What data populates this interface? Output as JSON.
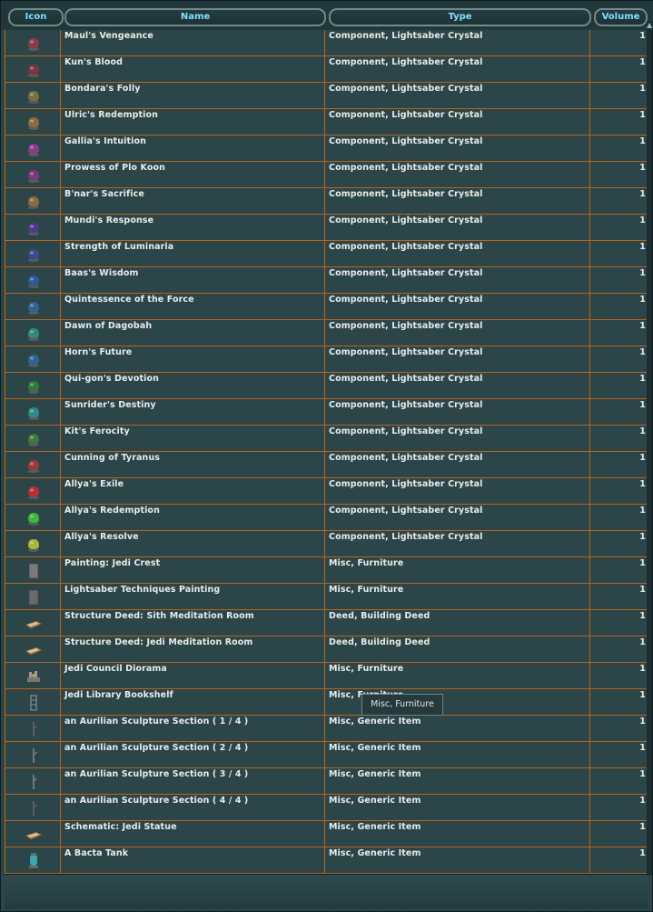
{
  "columns": {
    "icon": "Icon",
    "name": "Name",
    "type": "Type",
    "volume": "Volume"
  },
  "rows": [
    {
      "name": "Maul's Vengeance",
      "type": "Component, Lightsaber Crystal",
      "volume": "1",
      "icon": "crystal-icon",
      "color": "#8a3b46"
    },
    {
      "name": "Kun's Blood",
      "type": "Component, Lightsaber Crystal",
      "volume": "1",
      "icon": "crystal-icon",
      "color": "#7d3440"
    },
    {
      "name": "Bondara's Folly",
      "type": "Component, Lightsaber Crystal",
      "volume": "1",
      "icon": "crystal-icon",
      "color": "#7a6e3e"
    },
    {
      "name": "Ulric's Redemption",
      "type": "Component, Lightsaber Crystal",
      "volume": "1",
      "icon": "crystal-icon",
      "color": "#8a6b3a"
    },
    {
      "name": "Gallia's Intuition",
      "type": "Component, Lightsaber Crystal",
      "volume": "1",
      "icon": "crystal-icon",
      "color": "#8b3a8a"
    },
    {
      "name": "Prowess of Plo Koon",
      "type": "Component, Lightsaber Crystal",
      "volume": "1",
      "icon": "crystal-icon",
      "color": "#7b3a78"
    },
    {
      "name": "B'nar's Sacrifice",
      "type": "Component, Lightsaber Crystal",
      "volume": "1",
      "icon": "crystal-icon",
      "color": "#8a6a3f"
    },
    {
      "name": "Mundi's Response",
      "type": "Component, Lightsaber Crystal",
      "volume": "1",
      "icon": "crystal-icon",
      "color": "#4c3a8a"
    },
    {
      "name": "Strength of Luminaria",
      "type": "Component, Lightsaber Crystal",
      "volume": "1",
      "icon": "crystal-icon",
      "color": "#3a4a8e"
    },
    {
      "name": "Baas's Wisdom",
      "type": "Component, Lightsaber Crystal",
      "volume": "1",
      "icon": "crystal-icon",
      "color": "#2e5a9a"
    },
    {
      "name": "Quintessence of the Force",
      "type": "Component, Lightsaber Crystal",
      "volume": "1",
      "icon": "crystal-icon",
      "color": "#2e6496"
    },
    {
      "name": "Dawn of Dagobah",
      "type": "Component, Lightsaber Crystal",
      "volume": "1",
      "icon": "crystal-icon",
      "color": "#2e8a80"
    },
    {
      "name": "Horn's Future",
      "type": "Component, Lightsaber Crystal",
      "volume": "1",
      "icon": "crystal-icon",
      "color": "#2e6494"
    },
    {
      "name": "Qui-gon's Devotion",
      "type": "Component, Lightsaber Crystal",
      "volume": "1",
      "icon": "crystal-icon",
      "color": "#2e7a3e"
    },
    {
      "name": "Sunrider's Destiny",
      "type": "Component, Lightsaber Crystal",
      "volume": "1",
      "icon": "crystal-icon",
      "color": "#2e8a86"
    },
    {
      "name": "Kit's Ferocity",
      "type": "Component, Lightsaber Crystal",
      "volume": "1",
      "icon": "crystal-icon",
      "color": "#3e7a3a"
    },
    {
      "name": "Cunning of Tyranus",
      "type": "Component, Lightsaber Crystal",
      "volume": "1",
      "icon": "crystal-icon",
      "color": "#9a3a3a"
    },
    {
      "name": "Allya's Exile",
      "type": "Component, Lightsaber Crystal",
      "volume": "1",
      "icon": "crystal-icon",
      "color": "#b83030"
    },
    {
      "name": "Allya's Redemption",
      "type": "Component, Lightsaber Crystal",
      "volume": "1",
      "icon": "crystal-icon",
      "color": "#3ab83a"
    },
    {
      "name": "Allya's Resolve",
      "type": "Component, Lightsaber Crystal",
      "volume": "1",
      "icon": "crystal-icon",
      "color": "#a8b83a"
    },
    {
      "name": "Painting: Jedi Crest",
      "type": "Misc, Furniture",
      "volume": "1",
      "icon": "painting-icon",
      "color": "#7a7a7a"
    },
    {
      "name": "Lightsaber Techniques Painting",
      "type": "Misc, Furniture",
      "volume": "1",
      "icon": "painting-icon",
      "color": "#6a6a6a"
    },
    {
      "name": "Structure Deed: Sith Meditation Room",
      "type": "Deed, Building Deed",
      "volume": "1",
      "icon": "deed-icon",
      "color": "#b08a5a"
    },
    {
      "name": "Structure Deed: Jedi Meditation Room",
      "type": "Deed, Building Deed",
      "volume": "1",
      "icon": "deed-icon",
      "color": "#b08a5a"
    },
    {
      "name": "Jedi Council Diorama",
      "type": "Misc, Furniture",
      "volume": "1",
      "icon": "diorama-icon",
      "color": "#9a9a9a"
    },
    {
      "name": "Jedi Library Bookshelf",
      "type": "Misc, Furniture",
      "volume": "1",
      "icon": "bookshelf-icon",
      "color": "#8a8a9a"
    },
    {
      "name": "an Aurilian Sculpture Section ( 1 / 4 )",
      "type": "Misc, Generic Item",
      "volume": "1",
      "icon": "sculpture-icon",
      "color": "#6a6a6a"
    },
    {
      "name": "an Aurilian Sculpture Section ( 2 / 4 )",
      "type": "Misc, Generic Item",
      "volume": "1",
      "icon": "sculpture-icon",
      "color": "#8a8a8a"
    },
    {
      "name": "an Aurilian Sculpture Section ( 3 / 4 )",
      "type": "Misc, Generic Item",
      "volume": "1",
      "icon": "sculpture-icon",
      "color": "#8a8a8a"
    },
    {
      "name": "an Aurilian Sculpture Section ( 4 / 4 )",
      "type": "Misc, Generic Item",
      "volume": "1",
      "icon": "sculpture-icon",
      "color": "#6a6a6a"
    },
    {
      "name": "Schematic: Jedi Statue",
      "type": "Misc, Generic Item",
      "volume": "1",
      "icon": "schematic-icon",
      "color": "#b08a5a"
    },
    {
      "name": "A Bacta Tank",
      "type": "Misc, Generic Item",
      "volume": "1",
      "icon": "bacta-tank-icon",
      "color": "#3aa8b0"
    }
  ],
  "tooltip": "Misc, Furniture",
  "colors": {
    "header_text": "#7ee1ff",
    "grid_line": "#b5651d",
    "background": "#2c4549",
    "text": "#e8ece8"
  }
}
